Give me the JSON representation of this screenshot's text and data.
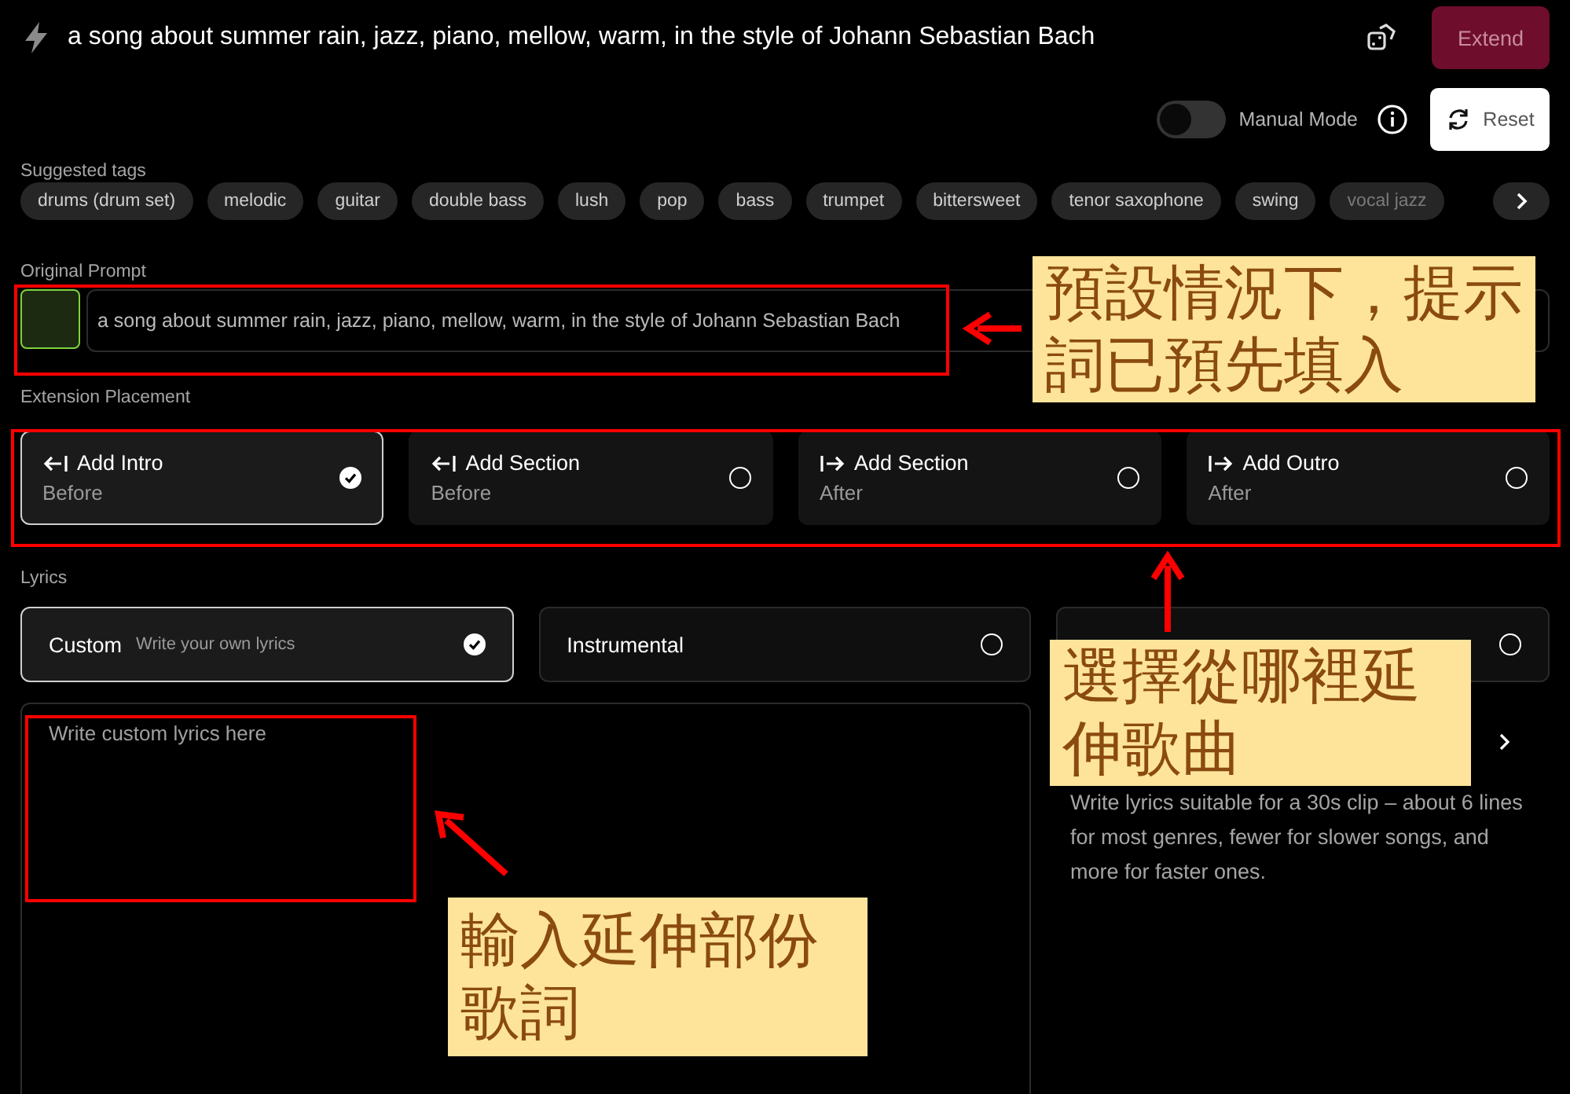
{
  "top_bar": {
    "prompt": "a song about summer rain, jazz, piano, mellow, warm, in the style of Johann Sebastian Bach",
    "extend_button": "Extend"
  },
  "controls": {
    "manual_mode": {
      "label": "Manual Mode",
      "on": false
    },
    "reset_button": "Reset"
  },
  "suggested_tags": {
    "label": "Suggested tags",
    "tags": [
      "drums (drum set)",
      "melodic",
      "guitar",
      "double bass",
      "lush",
      "pop",
      "bass",
      "trumpet",
      "bittersweet",
      "tenor saxophone",
      "swing",
      "vocal jazz"
    ]
  },
  "original_prompt": {
    "label": "Original Prompt",
    "value": "a song about summer rain, jazz, piano, mellow, warm, in the style of Johann Sebastian Bach"
  },
  "extension_placement": {
    "label": "Extension Placement",
    "options": [
      {
        "kind": "before",
        "title": "Add Intro",
        "subtitle": "Before",
        "selected": true
      },
      {
        "kind": "before",
        "title": "Add Section",
        "subtitle": "Before",
        "selected": false
      },
      {
        "kind": "after",
        "title": "Add Section",
        "subtitle": "After",
        "selected": false
      },
      {
        "kind": "after",
        "title": "Add Outro",
        "subtitle": "After",
        "selected": false
      }
    ]
  },
  "lyrics": {
    "label": "Lyrics",
    "options": [
      {
        "title": "Custom",
        "subtitle": "Write your own lyrics",
        "selected": true
      },
      {
        "title": "Instrumental",
        "selected": false
      },
      {
        "selected": false
      }
    ],
    "placeholder": "Write custom lyrics here",
    "hint": "Write lyrics suitable for a 30s clip – about 6 lines for most genres, fewer for slower songs, and more for faster ones."
  },
  "annotations": [
    {
      "kind": "box"
    },
    {
      "kind": "box"
    },
    {
      "kind": "box"
    },
    {
      "kind": "arrow"
    },
    {
      "kind": "arrow"
    },
    {
      "kind": "arrow"
    },
    {
      "kind": "callout",
      "text": "預設情況下，提示詞已預先填入"
    },
    {
      "kind": "callout",
      "text": "選擇從哪裡延伸歌曲"
    },
    {
      "kind": "callout",
      "text": "輸入延伸部份歌詞"
    }
  ]
}
